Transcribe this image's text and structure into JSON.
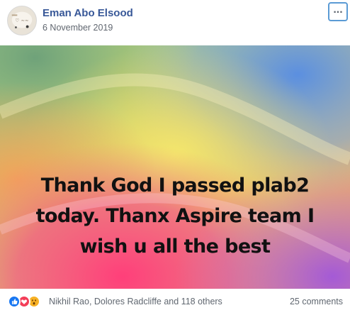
{
  "post": {
    "author": "Eman Abo Elsood",
    "date": "6 November 2019",
    "more_icon": "more-horizontal-icon",
    "text": "Thank God I passed plab2 today. Thanx Aspire team I wish u all the best"
  },
  "footer": {
    "reactions": [
      "like-icon",
      "love-icon",
      "wow-icon"
    ],
    "reactors": "Nikhil Rao, Dolores Radcliffe and 118 others",
    "comments": "25 comments"
  },
  "colors": {
    "author_link": "#385898",
    "muted_text": "#606770",
    "like": "#1877f2",
    "love": "#f33e58",
    "wow": "#f7b125",
    "focus_ring": "#5b9bd5"
  }
}
